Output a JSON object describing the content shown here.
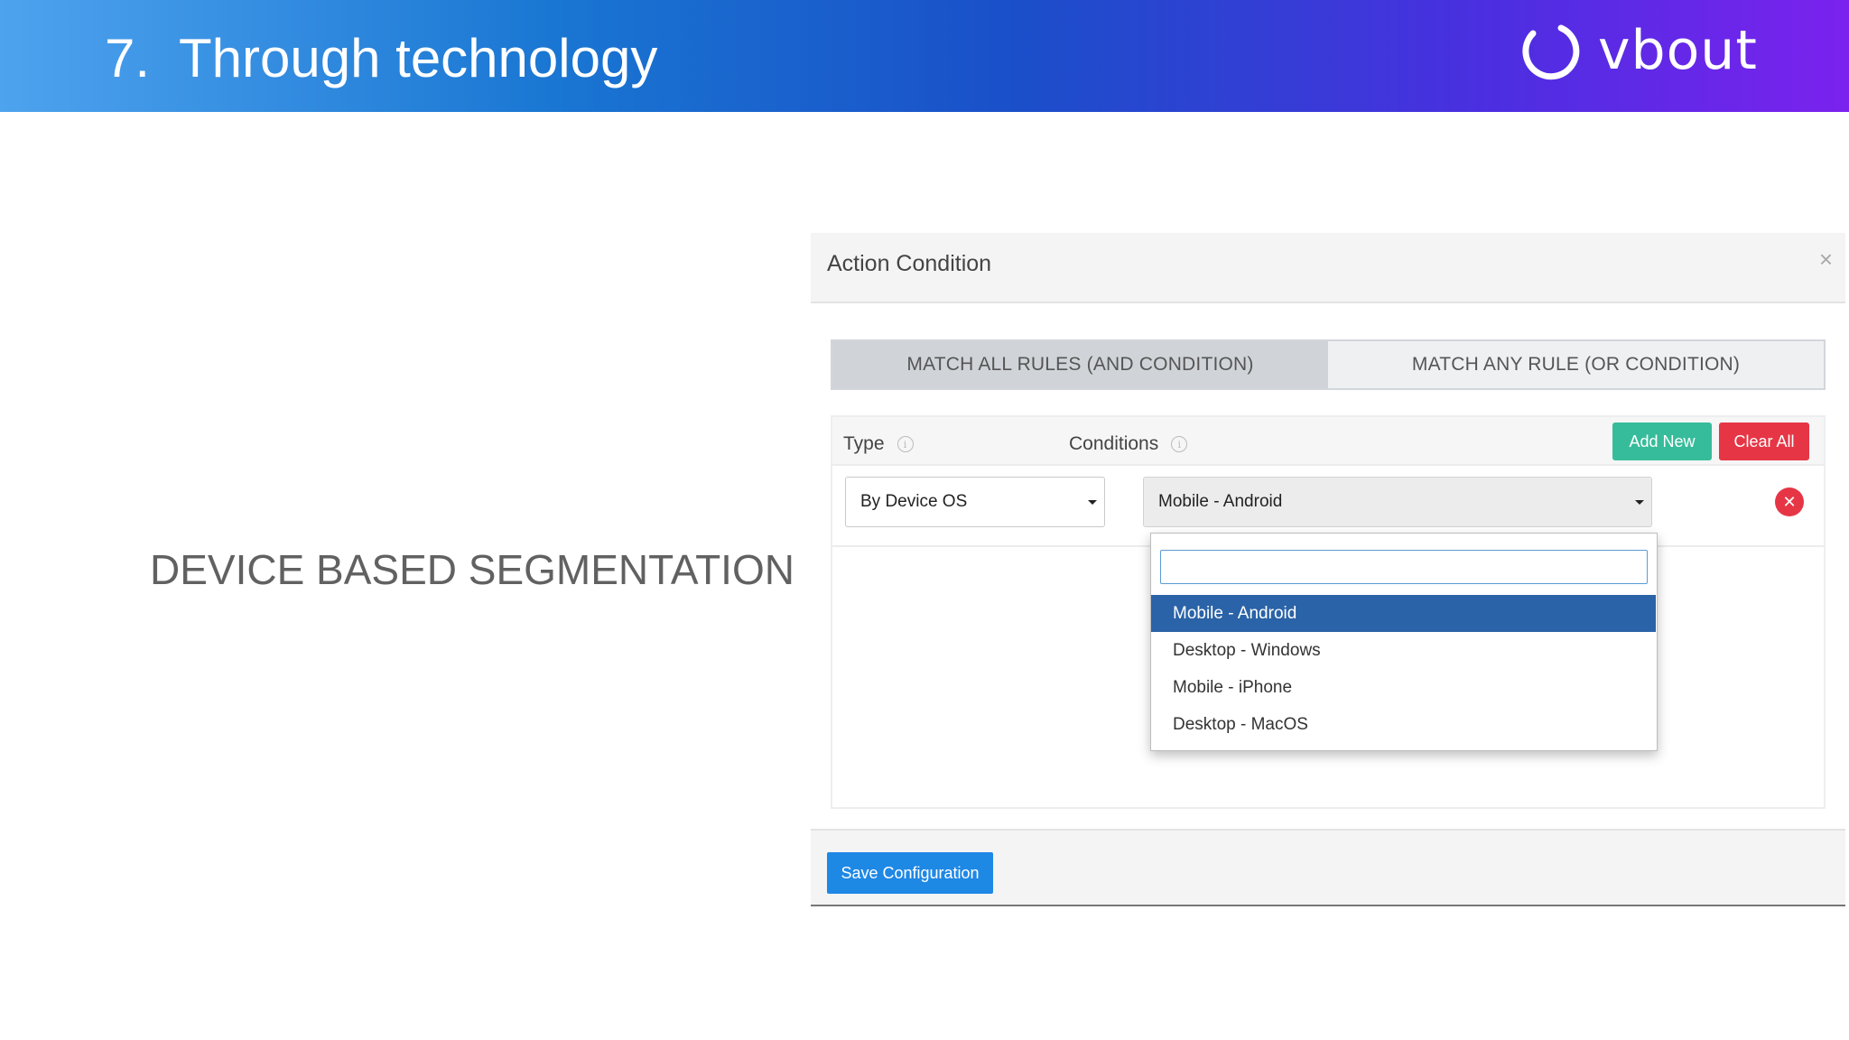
{
  "banner": {
    "number": "7.",
    "title": "Through technology",
    "logo_text": "vbout"
  },
  "left_label": "DEVICE BASED SEGMENTATION",
  "modal": {
    "title": "Action Condition",
    "close_glyph": "×",
    "tabs": [
      {
        "label": "MATCH ALL RULES (AND CONDITION)",
        "active": true
      },
      {
        "label": "MATCH ANY RULE (OR CONDITION)",
        "active": false
      }
    ],
    "panel": {
      "type_label": "Type",
      "conditions_label": "Conditions",
      "info_glyph": "i",
      "add_new_label": "Add New",
      "clear_all_label": "Clear All",
      "row": {
        "type_value": "By Device OS",
        "condition_value": "Mobile - Android",
        "remove_glyph": "✕"
      }
    },
    "dropdown": {
      "search_value": "",
      "options": [
        {
          "label": "Mobile - Android",
          "selected": true
        },
        {
          "label": "Desktop - Windows",
          "selected": false
        },
        {
          "label": "Mobile - iPhone",
          "selected": false
        },
        {
          "label": "Desktop - MacOS",
          "selected": false
        }
      ]
    },
    "save_label": "Save Configuration"
  },
  "colors": {
    "add_new": "#37bc9b",
    "clear_all": "#e63646",
    "selected_option": "#2a63a7",
    "save_button": "#1e88e5"
  }
}
